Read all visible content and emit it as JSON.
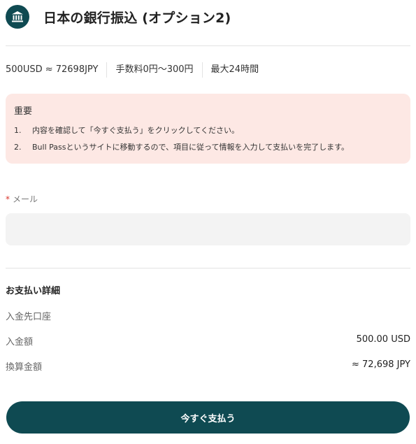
{
  "header": {
    "icon": "bank-icon",
    "title": "日本の銀行振込 (オプション2)"
  },
  "summary": {
    "rate": "500USD ≈ 72698JPY",
    "fee": "手数料0円〜300円",
    "time": "最大24時間"
  },
  "notice": {
    "title": "重要",
    "items": [
      {
        "num": "1.",
        "text": "内容を確認して「今すぐ支払う」をクリックしてください。"
      },
      {
        "num": "2.",
        "text": "Bull Passというサイトに移動するので、項目に従って情報を入力して支払いを完了します。"
      }
    ]
  },
  "form": {
    "email_required_mark": "*",
    "email_label": "メール",
    "email_value": "",
    "email_placeholder": ""
  },
  "details": {
    "title": "お支払い詳細",
    "rows": [
      {
        "label": "入金先口座",
        "value": ""
      },
      {
        "label": "入金額",
        "value": "500.00 USD"
      },
      {
        "label": "換算金額",
        "value": "≈ 72,698 JPY"
      }
    ]
  },
  "pay_button": {
    "label": "今すぐ支払う"
  },
  "colors": {
    "primary": "#0f4a52",
    "notice_bg": "#fde8e4",
    "input_bg": "#f3f3f3",
    "required": "#d9342b"
  }
}
